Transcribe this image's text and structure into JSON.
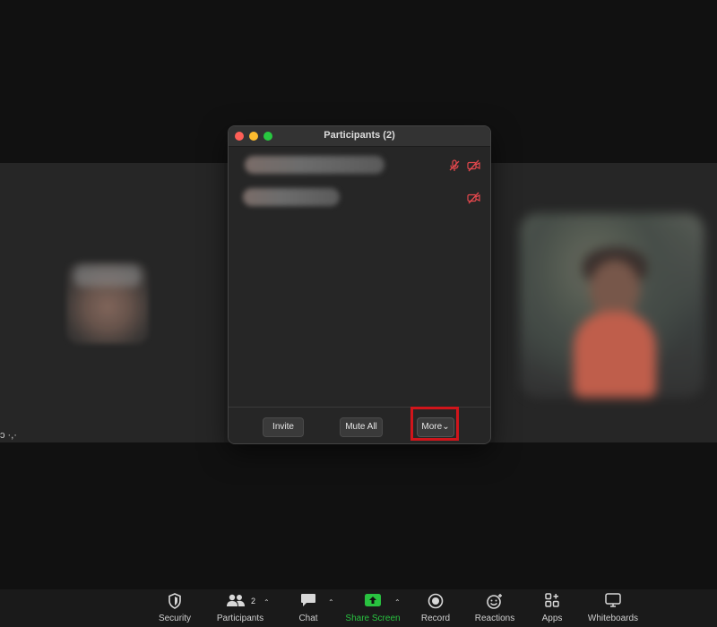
{
  "window": {
    "title": "Participants (2)",
    "participants": [
      {
        "mic_icon": "mic-muted-icon",
        "video_icon": "video-off-icon"
      },
      {
        "video_icon": "video-off-icon"
      }
    ],
    "buttons": {
      "invite": "Invite",
      "mute_all": "Mute All",
      "more": "More"
    }
  },
  "stray_text": "ɔ ·,·",
  "toolbar": {
    "security": "Security",
    "participants": "Participants",
    "participants_count": "2",
    "chat": "Chat",
    "share_screen": "Share Screen",
    "record": "Record",
    "reactions": "Reactions",
    "apps": "Apps",
    "whiteboards": "Whiteboards"
  },
  "colors": {
    "accent_green": "#29c240",
    "highlight_red": "#d0151b",
    "muted_icon_red": "#e5484d"
  }
}
